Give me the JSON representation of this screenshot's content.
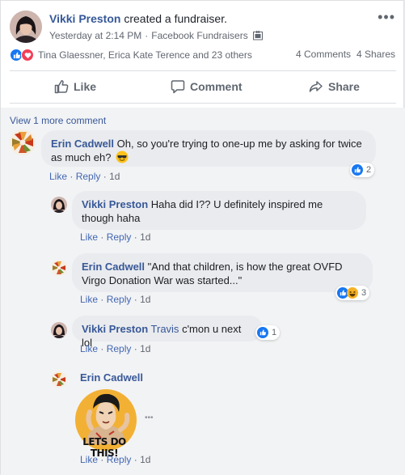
{
  "post": {
    "author": "Vikki Preston",
    "action": "created a fundraiser.",
    "time": "Yesterday at 2:14 PM",
    "sep": "·",
    "source": "Facebook Fundraisers",
    "more": "•••",
    "reactors": "Tina Glaessner, Erica Kate Terence and 23 others",
    "comments_count": "4 Comments",
    "shares_count": "4 Shares"
  },
  "actions": {
    "like": "Like",
    "comment": "Comment",
    "share": "Share"
  },
  "view_more": "View 1 more comment",
  "colors": {
    "link": "#385898",
    "like_blue": "#1877f2",
    "love_red": "#f33e58",
    "haha_yellow": "#f7b125"
  },
  "comments": [
    {
      "name": "Erin Cadwell",
      "text": "Oh, so you're trying to one-up me by asking for twice as much eh?",
      "emoji": "sunglasses-emoji",
      "like": "Like",
      "reply": "Reply",
      "time": "1d",
      "dot": "·",
      "reactions": "2"
    },
    {
      "name": "Vikki Preston",
      "text": "Haha did I?? U definitely inspired me though haha",
      "like": "Like",
      "reply": "Reply",
      "time": "1d",
      "dot": "·"
    },
    {
      "name": "Erin Cadwell",
      "text": "\"And that children, is how the great OVFD Virgo Donation War was started...\"",
      "like": "Like",
      "reply": "Reply",
      "time": "1d",
      "dot": "·",
      "reactions": "3"
    },
    {
      "name": "Vikki Preston",
      "mention": "Travis",
      "text": "c'mon u next lol",
      "like": "Like",
      "reply": "Reply",
      "time": "1d",
      "dot": "·",
      "reactions": "1"
    },
    {
      "name": "Erin Cadwell",
      "sticker_text": "LETS DO THIS!",
      "more": "•••",
      "like": "Like",
      "reply": "Reply",
      "time": "1d",
      "dot": "·"
    }
  ]
}
